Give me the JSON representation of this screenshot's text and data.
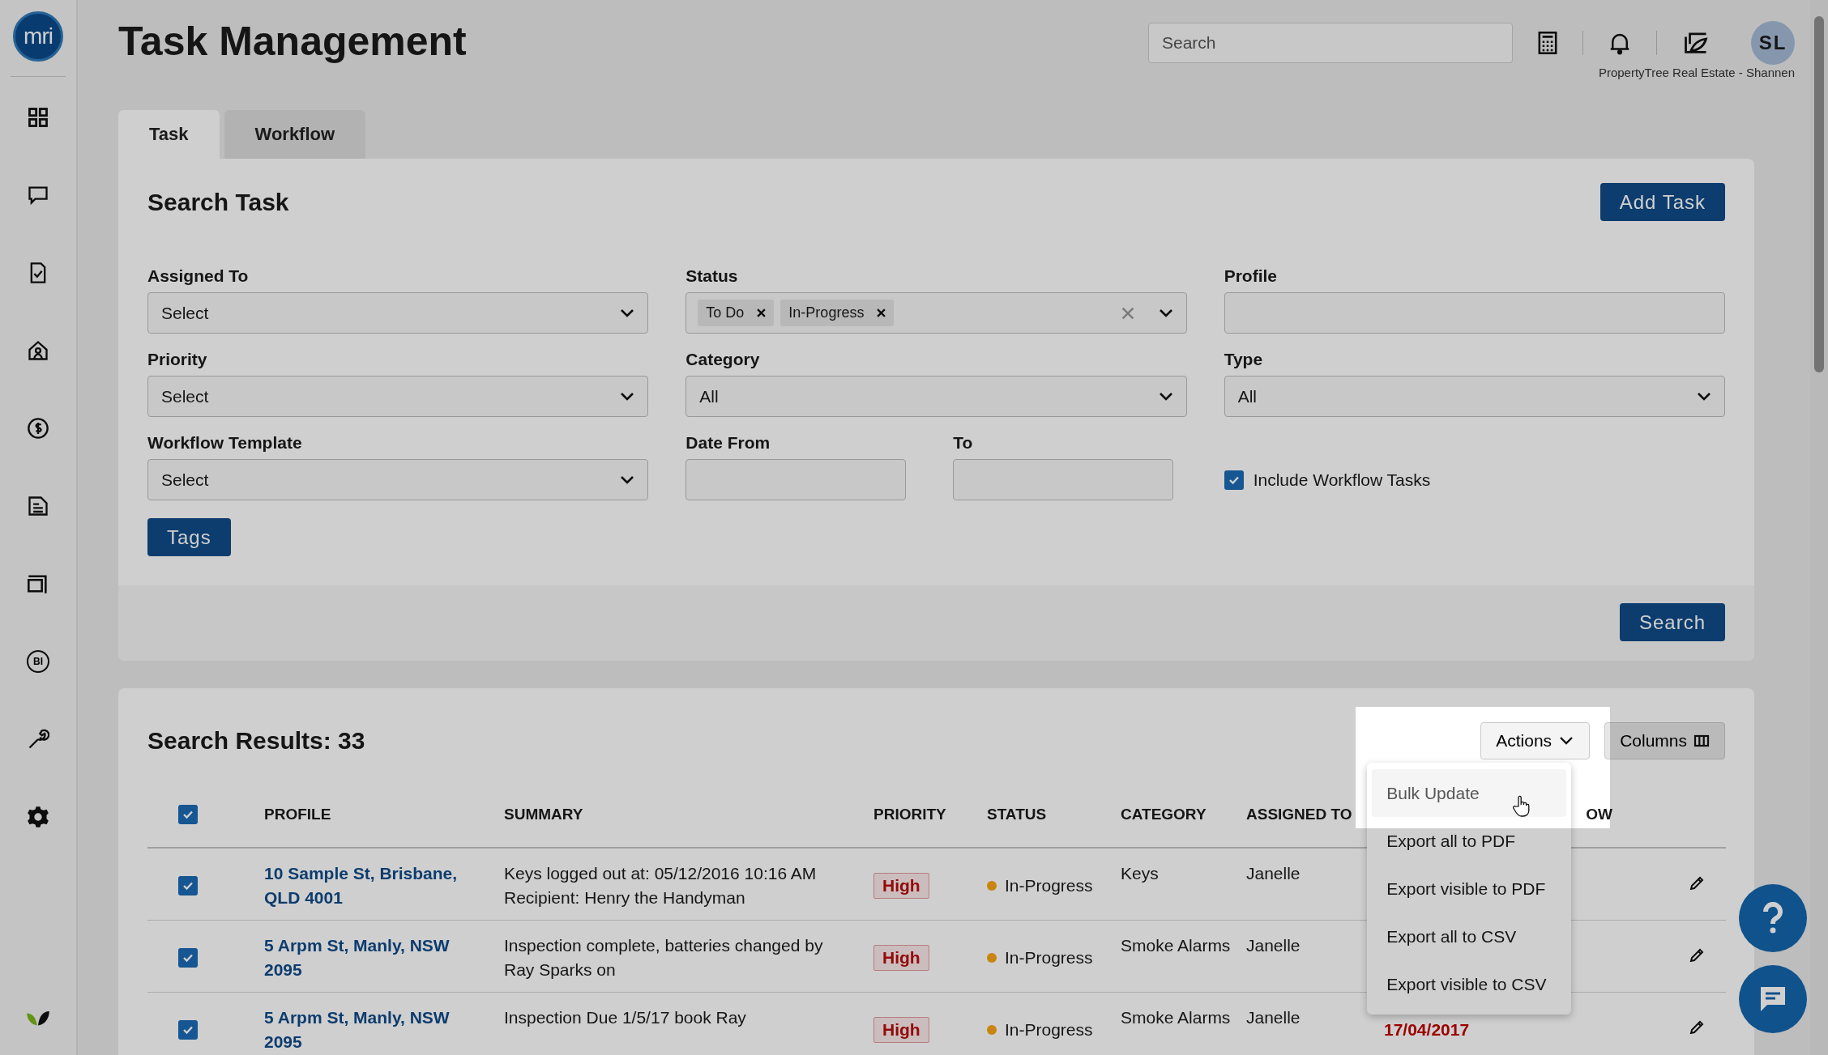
{
  "logo": {
    "text": "mri"
  },
  "sidebar": {
    "items": [
      {
        "kind": "grid"
      },
      {
        "kind": "chat"
      },
      {
        "kind": "doc-check"
      },
      {
        "kind": "home"
      },
      {
        "kind": "dollar"
      },
      {
        "kind": "document"
      },
      {
        "kind": "frame"
      },
      {
        "kind": "badge",
        "text": "BI"
      },
      {
        "kind": "wrench"
      },
      {
        "kind": "gear"
      }
    ]
  },
  "header": {
    "title": "Task Management",
    "search": {
      "placeholder": "Search"
    },
    "avatar": "SL",
    "company": "PropertyTree Real Estate - Shannen"
  },
  "tabs": [
    {
      "label": "Task",
      "selected": true
    },
    {
      "label": "Workflow",
      "selected": false
    }
  ],
  "search_panel": {
    "title": "Search Task",
    "add_button": "Add Task",
    "fields": [
      {
        "label": "Assigned To",
        "kind": "select",
        "value": "Select"
      },
      {
        "label": "Status",
        "kind": "tags",
        "tags": [
          "To Do",
          "In-Progress"
        ]
      },
      {
        "label": "Profile",
        "kind": "text"
      },
      {
        "label": "Priority",
        "kind": "select",
        "value": "Select"
      },
      {
        "label": "Category",
        "kind": "select",
        "value": "All"
      },
      {
        "label": "Type",
        "kind": "select",
        "value": "All"
      },
      {
        "label": "Workflow Template",
        "kind": "select",
        "value": "Select"
      },
      {
        "kind": "dates",
        "from_label": "Date From",
        "to_label": "To"
      },
      {
        "kind": "checkbox",
        "label": "Include Workflow Tasks",
        "checked": true
      }
    ],
    "tags_button": "Tags",
    "search_button": "Search"
  },
  "results": {
    "title": "Search Results: 33",
    "actions_button": "Actions",
    "columns_button": "Columns",
    "actions_menu": [
      {
        "label": "Bulk Update",
        "selected": true
      },
      {
        "label": "Export all to PDF",
        "selected": false
      },
      {
        "label": "Export visible to PDF",
        "selected": false
      },
      {
        "label": "Export all to CSV",
        "selected": false
      },
      {
        "label": "Export visible to CSV",
        "selected": false
      }
    ],
    "all_checked": true,
    "columns": [
      "PROFILE",
      "SUMMARY",
      "PRIORITY",
      "STATUS",
      "CATEGORY",
      "ASSIGNED TO",
      "OW"
    ],
    "rows": [
      {
        "checked": true,
        "profile": "10 Sample St, Brisbane, QLD 4001",
        "summary": "Keys logged out at: 05/12/2016 10:16 AM Recipient: Henry the Handyman",
        "priority": "High",
        "status": {
          "text": "In-Progress",
          "color": "#c98510"
        },
        "category": "Keys",
        "assigned": "Janelle"
      },
      {
        "checked": true,
        "profile": "5 Arpm St, Manly, NSW 2095",
        "summary": "Inspection complete, batteries changed by Ray Sparks on",
        "priority": "High",
        "status": {
          "text": "In-Progress",
          "color": "#c98510"
        },
        "category": "Smoke Alarms",
        "assigned": "Janelle"
      },
      {
        "checked": true,
        "profile": "5 Arpm St, Manly, NSW 2095",
        "summary": "Inspection Due 1/5/17 book Ray",
        "priority": "High",
        "status": {
          "text": "In-Progress",
          "color": "#c98510"
        },
        "category": "Smoke Alarms",
        "assigned": "Janelle",
        "date": "17/04/2017"
      }
    ]
  }
}
